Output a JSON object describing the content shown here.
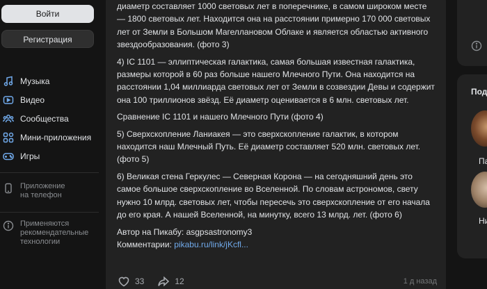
{
  "auth": {
    "login_label": "Войти",
    "register_label": "Регистрация"
  },
  "nav": {
    "items": [
      {
        "label": "Музыка",
        "icon": "music-icon"
      },
      {
        "label": "Видео",
        "icon": "video-icon"
      },
      {
        "label": "Сообщества",
        "icon": "communities-icon"
      },
      {
        "label": "Мини-приложения",
        "icon": "apps-icon"
      },
      {
        "label": "Игры",
        "icon": "gamepad-icon"
      }
    ],
    "app_promo": {
      "line1": "Приложение",
      "line2": "на телефон"
    },
    "tech_note": {
      "line1": "Применяются",
      "line2": "рекомендательные",
      "line3": "технологии"
    }
  },
  "post": {
    "paragraphs": [
      "диаметр составляет 1000 световых лет в поперечнике, в самом широком месте — 1800 световых лет. Находится она на расстоянии примерно 170 000 световых лет от Земли в Большом Магеллановом Облаке и является областью активного звездообразования. (фото 3)",
      "4) IC 1101 — эллиптическая галактика, самая большая известная галактика, размеры которой в 60 раз больше нашего Млечного Пути. Она находится на расстоянии 1,04 миллиарда световых лет от Земли в созвездии Девы и содержит она 100 триллионов звёзд. Её диаметр оценивается в 6 млн. световых лет.",
      "Сравнение IC 1101 и нашего Млечного Пути (фото 4)",
      "5) Сверхскопление Ланиакея — это сверхскопление галактик, в котором находится наш Млечный Путь. Её диаметр составляет 520 млн. световых лет. (фото 5)",
      "6) Великая стена Геркулес — Северная Корона — на сегодняшний день это самое большое сверхскопление во Вселенной. По словам астрономов, свету нужно 10 млрд. световых лет, чтобы пересечь это сверхскопление от его начала до его края. А нашей Вселенной, на минутку, всего 13 млрд. лет. (фото 6)"
    ],
    "author_line": "Автор на Пикабу: asgpsastronomy3",
    "comments_prefix": "Комментарии: ",
    "comments_link": "pikabu.ru/link/jKcfl...",
    "likes": "33",
    "shares": "12",
    "time": "1 д назад"
  },
  "right": {
    "title": "Под",
    "names": [
      "Па",
      "Ник"
    ]
  }
}
